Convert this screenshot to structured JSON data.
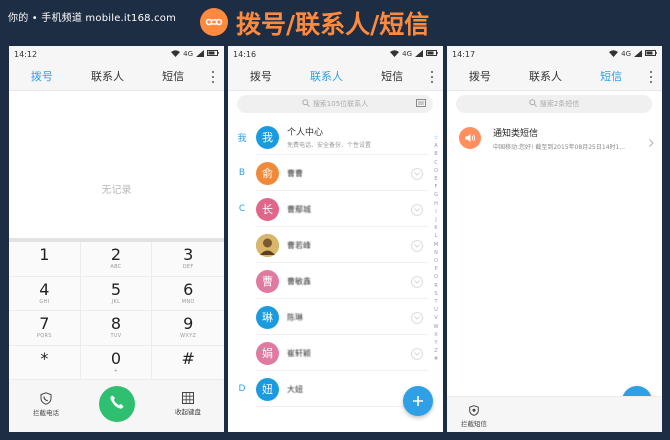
{
  "banner": {
    "watermark": "你的 • 手机频道 mobile.it168.com",
    "title": "拨号/联系人/短信",
    "accent_color": "#ff8a3d",
    "icon": "exchange-icon"
  },
  "phone1": {
    "time": "14:12",
    "network": "4G",
    "tabs": [
      "拨号",
      "联系人",
      "短信"
    ],
    "active_tab": "拨号",
    "empty_text": "无记录",
    "keys": [
      {
        "num": "1",
        "letters": ""
      },
      {
        "num": "2",
        "letters": "ABC"
      },
      {
        "num": "3",
        "letters": "DEF"
      },
      {
        "num": "4",
        "letters": "GHI"
      },
      {
        "num": "5",
        "letters": "JKL"
      },
      {
        "num": "6",
        "letters": "MNO"
      },
      {
        "num": "7",
        "letters": "PQRS"
      },
      {
        "num": "8",
        "letters": "TUV"
      },
      {
        "num": "9",
        "letters": "WXYZ"
      },
      {
        "num": "*",
        "letters": ""
      },
      {
        "num": "0",
        "letters": "+"
      },
      {
        "num": "#",
        "letters": ""
      }
    ],
    "left_button": "拦截电话",
    "right_button": "收起键盘",
    "call_color": "#2fbf71"
  },
  "phone2": {
    "time": "14:16",
    "network": "4G",
    "tabs": [
      "拨号",
      "联系人",
      "短信"
    ],
    "active_tab": "联系人",
    "search_placeholder": "搜索105位联系人",
    "contacts": [
      {
        "index": "我",
        "avatar_char": "我",
        "name": "个人中心",
        "sub": "免费电话、安全备份、个性设置",
        "color": "#1a9be0",
        "blurred": false
      },
      {
        "index": "B",
        "avatar_char": "俞",
        "name": "曹曹",
        "sub": "",
        "color": "#f08a3a",
        "blurred": true
      },
      {
        "index": "C",
        "avatar_char": "长",
        "name": "曹鄢城",
        "sub": "",
        "color": "#e0668c",
        "blurred": true
      },
      {
        "index": "",
        "avatar_char": "",
        "name": "曹若峰",
        "sub": "",
        "color": "#c9a24a",
        "blurred": true
      },
      {
        "index": "",
        "avatar_char": "曹",
        "name": "曹敏鑫",
        "sub": "",
        "color": "#e07aa0",
        "blurred": true
      },
      {
        "index": "",
        "avatar_char": "琳",
        "name": "陈琳",
        "sub": "",
        "color": "#1a9be0",
        "blurred": true
      },
      {
        "index": "",
        "avatar_char": "娟",
        "name": "崔轩颖",
        "sub": "",
        "color": "#e07aa0",
        "blurred": true
      },
      {
        "index": "D",
        "avatar_char": "妞",
        "name": "大妞",
        "sub": "",
        "color": "#1a9be0",
        "blurred": true
      }
    ],
    "alpha_index": [
      "☆",
      "A",
      "B",
      "C",
      "D",
      "E",
      "F",
      "G",
      "H",
      "I",
      "J",
      "K",
      "L",
      "M",
      "N",
      "O",
      "P",
      "Q",
      "R",
      "S",
      "T",
      "U",
      "V",
      "W",
      "X",
      "Y",
      "Z",
      "#"
    ],
    "fab_color": "#2f9fe6"
  },
  "phone3": {
    "time": "14:17",
    "network": "4G",
    "tabs": [
      "拨号",
      "联系人",
      "短信"
    ],
    "active_tab": "短信",
    "search_placeholder": "搜索2条短信",
    "message": {
      "title": "通知类短信",
      "preview": "中国移动:您好!  截至到2015年08月25日14时1..."
    },
    "bottom_button": "拦截短信",
    "fab_color": "#2f9fe6"
  }
}
